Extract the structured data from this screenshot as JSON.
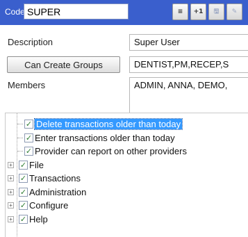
{
  "header": {
    "code_label": "Code",
    "code_value": "SUPER",
    "toolbar": [
      {
        "icon": "align-left-icon",
        "glyph": "≡"
      },
      {
        "icon": "plus-one-icon",
        "glyph": "+1"
      },
      {
        "icon": "save-icon",
        "glyph": "🖫"
      },
      {
        "icon": "edit-icon",
        "glyph": "✎"
      }
    ]
  },
  "form": {
    "description_label": "Description",
    "description_value": "Super User",
    "can_create_groups_label": "Can Create Groups",
    "can_create_groups_value": "DENTIST,PM,RECEP,S",
    "members_label": "Members",
    "members_value": "ADMIN, ANNA, DEMO,"
  },
  "tree": {
    "items": [
      {
        "label": "Delete transactions older than today",
        "checked": true,
        "expandable": false,
        "selected": true
      },
      {
        "label": "Enter transactions older than today",
        "checked": true,
        "expandable": false,
        "selected": false
      },
      {
        "label": "Provider can report on other providers",
        "checked": true,
        "expandable": false,
        "selected": false
      },
      {
        "label": "File",
        "checked": true,
        "expandable": true,
        "selected": false
      },
      {
        "label": "Transactions",
        "checked": true,
        "expandable": true,
        "selected": false
      },
      {
        "label": "Administration",
        "checked": true,
        "expandable": true,
        "selected": false
      },
      {
        "label": "Configure",
        "checked": true,
        "expandable": true,
        "selected": false
      },
      {
        "label": "Help",
        "checked": true,
        "expandable": true,
        "selected": false
      }
    ]
  },
  "colors": {
    "header_bg": "#3a5fcd",
    "selection_bg": "#3399ff",
    "check_color": "#2e7d32"
  }
}
